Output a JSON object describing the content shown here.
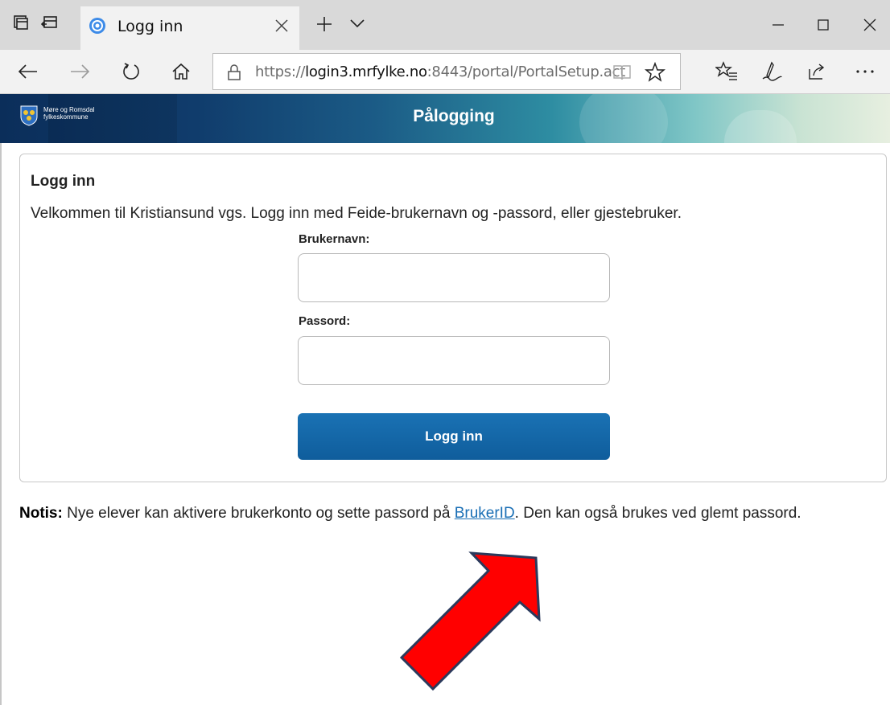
{
  "tab": {
    "title": "Logg inn"
  },
  "address": {
    "prefix": "https://",
    "host": "login3.mrfylke.no",
    "path": ":8443/portal/PortalSetup.act"
  },
  "header": {
    "org_line1": "Møre og Romsdal",
    "org_line2": "fylkeskommune",
    "title": "Pålogging"
  },
  "login": {
    "heading": "Logg inn",
    "welcome": "Velkommen til Kristiansund vgs. Logg inn med Feide-brukernavn og -passord, eller gjestebruker.",
    "username_label": "Brukernavn:",
    "username_value": "",
    "password_label": "Passord:",
    "password_value": "",
    "button_label": "Logg inn"
  },
  "notice": {
    "label": "Notis:",
    "text_before": " Nye elever kan aktivere brukerkonto og sette passord på ",
    "link": "BrukerID",
    "text_after": ". Den kan også brukes ved glemt passord."
  },
  "colors": {
    "accent_button": "#1468aa",
    "annotation_arrow": "#ff0000",
    "arrow_outline": "#2b3a5c"
  }
}
